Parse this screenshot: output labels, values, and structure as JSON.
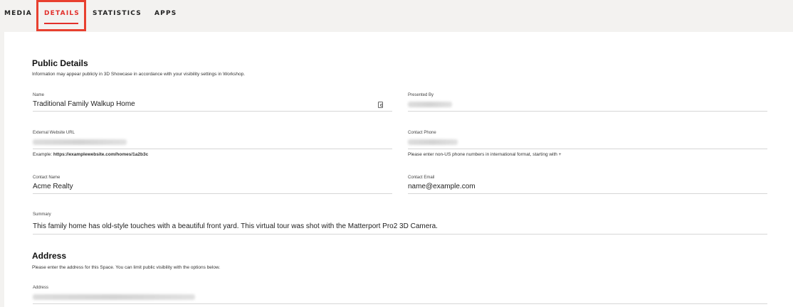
{
  "tabs": [
    {
      "label": "MEDIA"
    },
    {
      "label": "DETAILS"
    },
    {
      "label": "STATISTICS"
    },
    {
      "label": "APPS"
    }
  ],
  "public_details": {
    "title": "Public Details",
    "description": "Information may appear publicly in 3D Showcase in accordance with your visibility settings in Workshop.",
    "fields": {
      "name": {
        "label": "Name",
        "value": "Traditional Family Walkup Home"
      },
      "presented_by": {
        "label": "Presented By"
      },
      "external_url": {
        "label": "External Website URL",
        "helper_prefix": "Example: ",
        "helper_example": "https://examplewebsite.com/homes/1a2b3c"
      },
      "contact_phone": {
        "label": "Contact Phone",
        "helper": "Please enter non-US phone numbers in international format, starting with +"
      },
      "contact_name": {
        "label": "Contact Name",
        "value": "Acme Realty"
      },
      "contact_email": {
        "label": "Contact Email",
        "value": "name@example.com"
      },
      "summary": {
        "label": "Summary",
        "value": "This family home has old-style touches with a beautiful front yard. This virtual tour was shot with the Matterport Pro2 3D Camera."
      }
    }
  },
  "address_section": {
    "title": "Address",
    "description": "Please enter the address for this Space. You can limit public visibility with the options below.",
    "address": {
      "label": "Address"
    }
  },
  "colors": {
    "accent": "#e2302b",
    "tab_bar_bg": "#f3f2f0",
    "panel_bg": "#ffffff"
  }
}
